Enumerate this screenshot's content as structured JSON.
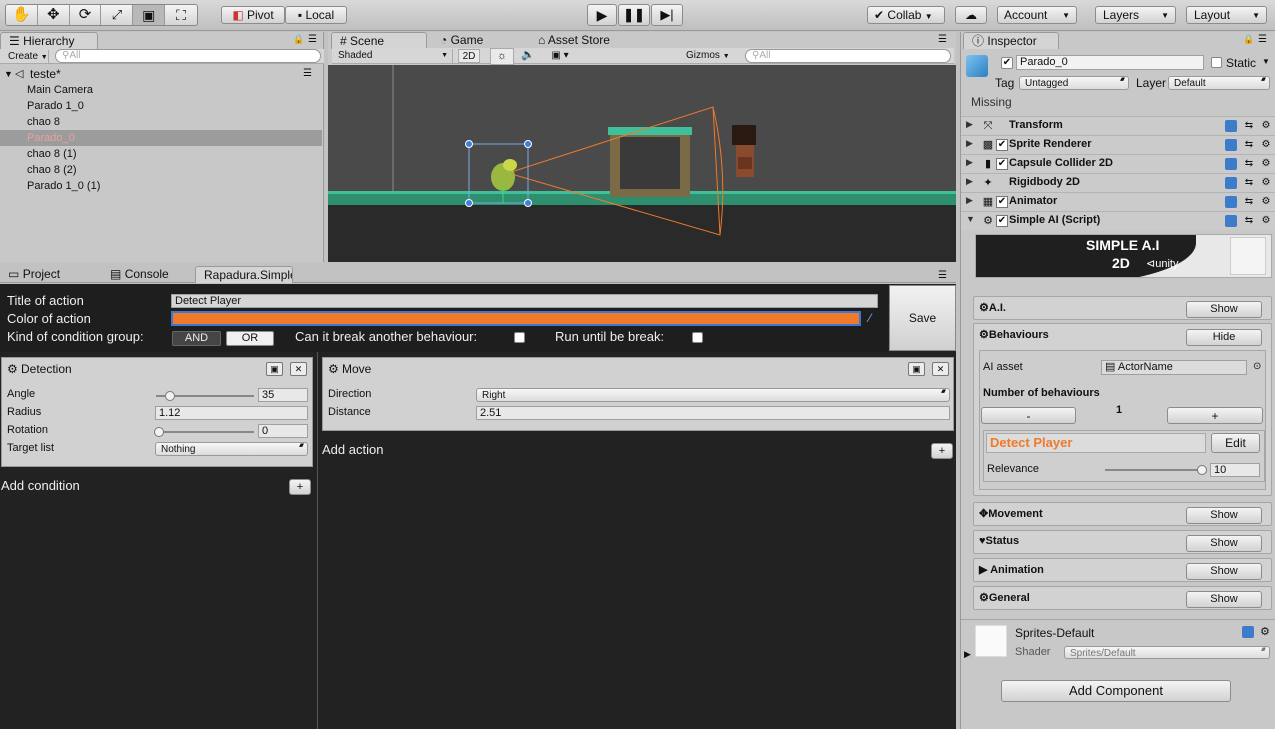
{
  "toolbar": {
    "tools": [
      "hand-tool",
      "move-tool",
      "rotate-tool",
      "scale-tool",
      "rect-tool",
      "transform-tool"
    ],
    "pivot": "Pivot",
    "local": "Local",
    "collab": "Collab",
    "account": "Account",
    "layers": "Layers",
    "layout": "Layout"
  },
  "hierarchy": {
    "tab": "Hierarchy",
    "create": "Create",
    "search_placeholder": "All",
    "scene": "teste*",
    "items": [
      "Main Camera",
      "Parado 1_0",
      "chao 8",
      "Parado_0",
      "chao 8 (1)",
      "chao 8 (2)",
      "Parado 1_0 (1)"
    ],
    "selected_index": 3
  },
  "scene_view": {
    "tabs": [
      "Scene",
      "Game",
      "Asset Store"
    ],
    "shading": "Shaded",
    "mode_2d": "2D",
    "gizmos": "Gizmos",
    "search_placeholder": "All"
  },
  "bottom_tabs": [
    "Project",
    "Console",
    "Rapadura.Simple"
  ],
  "action_editor": {
    "title_label": "Title of action",
    "title_value": "Detect Player",
    "color_label": "Color of action",
    "color_value": "#f07a2a",
    "condition_group_label": "Kind of condition group:",
    "and_label": "AND",
    "or_label": "OR",
    "break_label": "Can it break another behaviour:",
    "run_until_label": "Run until be break:",
    "save_label": "Save"
  },
  "detection_node": {
    "title": "Detection",
    "rows": [
      {
        "label": "Angle",
        "value": "35",
        "slider": 0.1
      },
      {
        "label": "Radius",
        "value": "1.12"
      },
      {
        "label": "Rotation",
        "value": "0",
        "slider": 0
      },
      {
        "label": "Target list",
        "value": "Nothing"
      }
    ],
    "add_condition": "Add condition"
  },
  "move_node": {
    "title": "Move",
    "rows": [
      {
        "label": "Direction",
        "value": "Right"
      },
      {
        "label": "Distance",
        "value": "2.51"
      }
    ],
    "add_action": "Add action"
  },
  "inspector": {
    "tab": "Inspector",
    "object_name": "Parado_0",
    "static_label": "Static",
    "tag_label": "Tag",
    "tag_value": "Untagged",
    "layer_label": "Layer",
    "layer_value": "Default",
    "missing": "Missing",
    "components": [
      {
        "name": "Transform",
        "checkbox": false
      },
      {
        "name": "Sprite Renderer",
        "checkbox": true
      },
      {
        "name": "Capsule Collider 2D",
        "checkbox": true
      },
      {
        "name": "Rigidbody 2D",
        "checkbox": false
      },
      {
        "name": "Animator",
        "checkbox": true
      },
      {
        "name": "Simple AI (Script)",
        "checkbox": true
      }
    ],
    "banner": {
      "title": "SIMPLE A.I",
      "subtitle": "2D",
      "brand": "unity"
    },
    "sections": {
      "ai": "A.I.",
      "behaviours": "Behaviours",
      "movement": "Movement",
      "status": "Status",
      "animation": "Animation",
      "general": "General"
    },
    "show": "Show",
    "hide": "Hide",
    "ai_asset_label": "AI asset",
    "ai_asset_value": "ActorName",
    "num_behaviours_label": "Number of behaviours",
    "num_behaviours_value": "1",
    "minus": "-",
    "plus": "+",
    "behaviour_name": "Detect Player",
    "edit": "Edit",
    "relevance_label": "Relevance",
    "relevance_value": "10",
    "material_name": "Sprites-Default",
    "shader_label": "Shader",
    "shader_value": "Sprites/Default",
    "add_component": "Add Component"
  }
}
